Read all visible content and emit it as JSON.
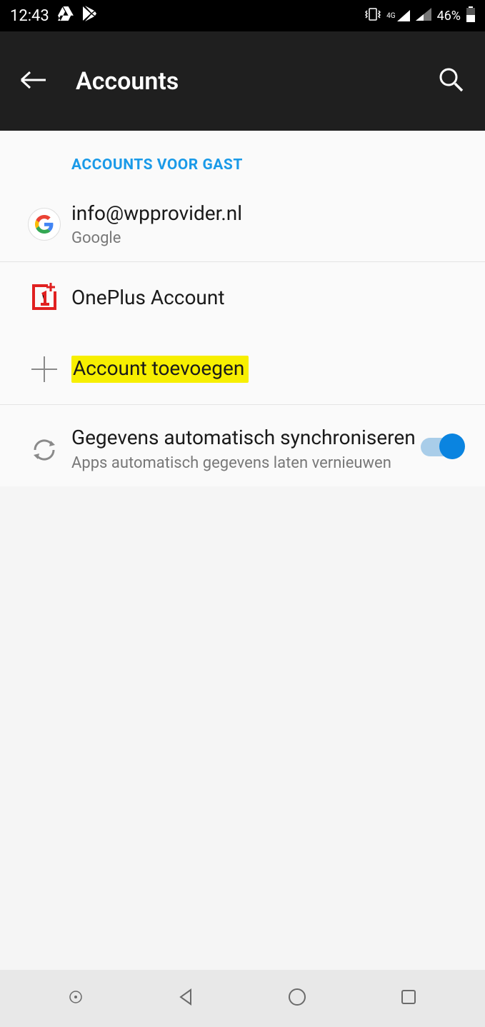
{
  "status": {
    "time": "12:43",
    "network_label": "4G",
    "battery_pct": "46%"
  },
  "appbar": {
    "title": "Accounts"
  },
  "section_header": "ACCOUNTS VOOR GAST",
  "accounts": {
    "google": {
      "email": "info@wpprovider.nl",
      "provider": "Google"
    },
    "oneplus": {
      "label": "OnePlus Account"
    },
    "add": {
      "label": "Account toevoegen"
    }
  },
  "sync": {
    "title": "Gegevens automatisch synchroniseren",
    "subtitle": "Apps automatisch gegevens laten vernieuwen",
    "enabled": true
  }
}
